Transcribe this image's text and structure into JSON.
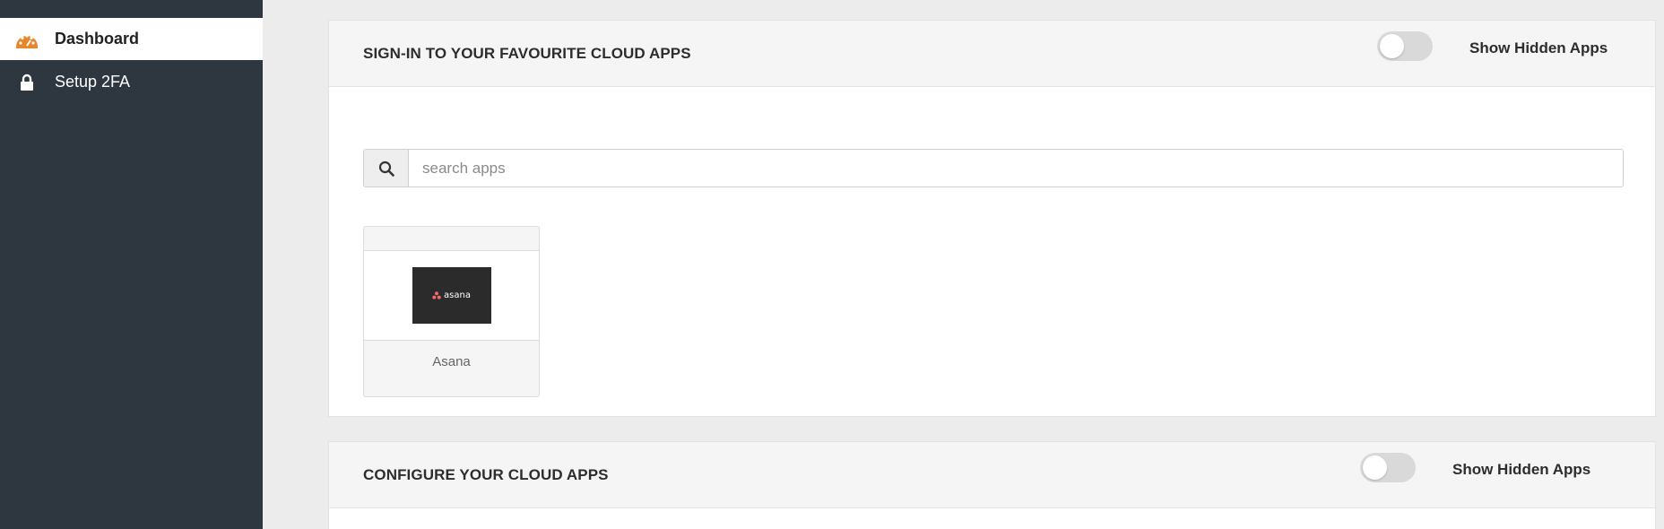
{
  "sidebar": {
    "items": [
      {
        "label": "Dashboard",
        "icon": "dashboard-gauge-icon",
        "active": true
      },
      {
        "label": "Setup 2FA",
        "icon": "lock-icon",
        "active": false
      }
    ]
  },
  "panels": {
    "signin": {
      "title": "SIGN-IN TO YOUR FAVOURITE CLOUD APPS",
      "toggle_label": "Show Hidden Apps",
      "search": {
        "placeholder": "search apps",
        "value": ""
      },
      "apps": [
        {
          "name": "Asana",
          "logo_text": "asana"
        }
      ]
    },
    "configure": {
      "title": "CONFIGURE YOUR CLOUD APPS",
      "toggle_label": "Show Hidden Apps"
    }
  },
  "colors": {
    "sidebar_bg": "#2e363f",
    "accent_orange": "#e8862a",
    "asana_pink": "#f06a6a"
  }
}
